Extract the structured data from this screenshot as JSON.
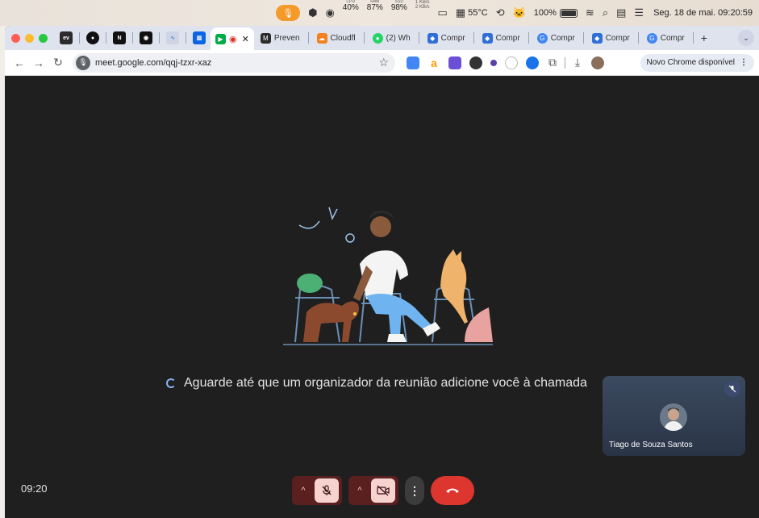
{
  "menubar": {
    "cpu_label": "CPU",
    "cpu_value": "40%",
    "ram_label": "RAM",
    "ram_value": "87%",
    "ssd_label": "SSD",
    "ssd_value": "98%",
    "net_up": "1 KB/s",
    "net_down": "2 KB/s",
    "temperature": "55°C",
    "battery": "100%",
    "datetime": "Seg. 18 de mai. 09:20:59"
  },
  "tabs": [
    {
      "label": "Preven",
      "color": "#2b2b2b",
      "glyph": "M"
    },
    {
      "label": "Cloudfl",
      "color": "#f48120",
      "glyph": "☁"
    },
    {
      "label": "(2) Wh",
      "color": "#25d366",
      "glyph": "●"
    },
    {
      "label": "Compr",
      "color": "#2f6fd6",
      "glyph": "◆"
    },
    {
      "label": "Compr",
      "color": "#2f6fd6",
      "glyph": "◆"
    },
    {
      "label": "Compr",
      "color": "#4285f4",
      "glyph": "G"
    },
    {
      "label": "Compr",
      "color": "#2f6fd6",
      "glyph": "◆"
    },
    {
      "label": "Compr",
      "color": "#4285f4",
      "glyph": "G"
    }
  ],
  "toolbar": {
    "url": "meet.google.com/qqj-tzxr-xaz",
    "update_label": "Novo Chrome disponível"
  },
  "meet": {
    "wait_message": "Aguarde até que um organizador da reunião adicione você à chamada",
    "self_name": "Tiago de Souza Santos",
    "clock": "09:20"
  },
  "colors": {
    "accent": "#8ab4f8",
    "hangup": "#dc362e",
    "muted_bg": "#f7d3d0",
    "muted_pair": "#5a1f1f",
    "meet_bg": "#1f1f1f"
  }
}
